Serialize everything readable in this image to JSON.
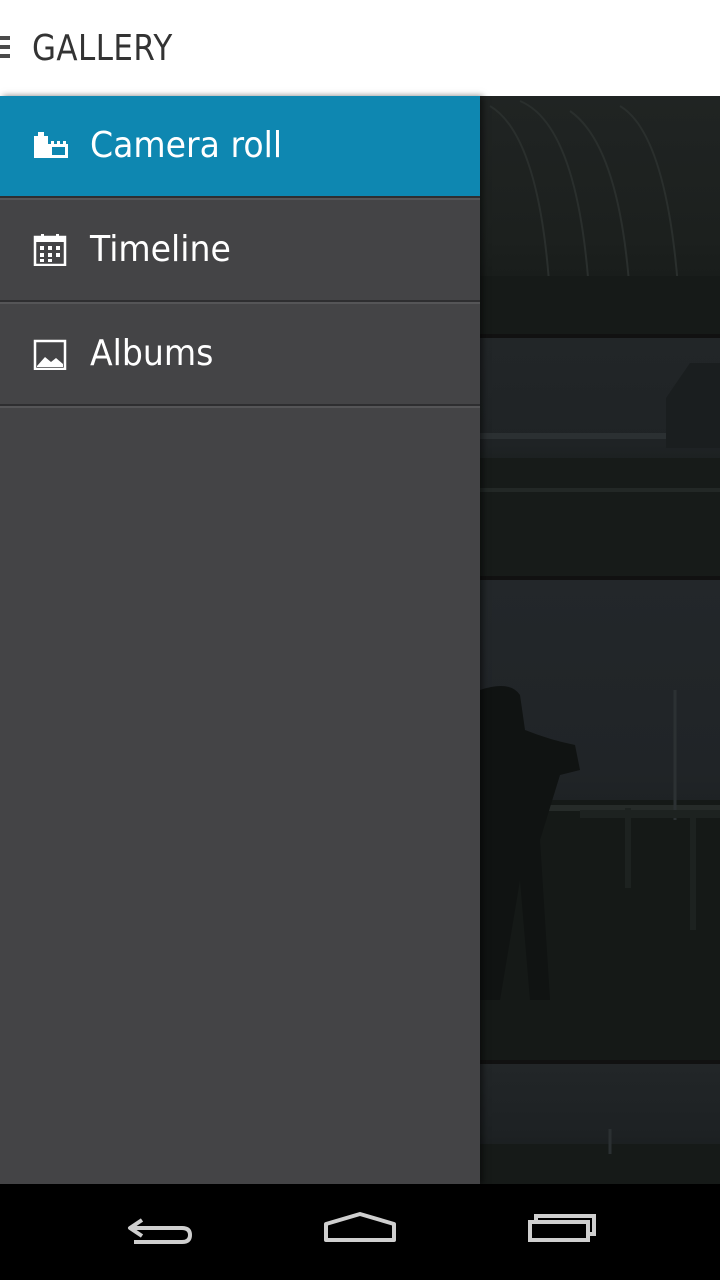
{
  "header": {
    "title": "GALLERY",
    "menu_icon": "hamburger-menu-icon"
  },
  "drawer": {
    "items": [
      {
        "label": "Camera roll",
        "icon": "camera-roll-icon",
        "active": true
      },
      {
        "label": "Timeline",
        "icon": "calendar-icon",
        "active": false
      },
      {
        "label": "Albums",
        "icon": "picture-icon",
        "active": false
      }
    ]
  },
  "navbar": {
    "buttons": [
      "back-icon",
      "home-icon",
      "recent-apps-icon"
    ]
  },
  "colors": {
    "accent": "#0e87b1",
    "drawer_bg": "#444446",
    "header_bg": "#ffffff"
  }
}
